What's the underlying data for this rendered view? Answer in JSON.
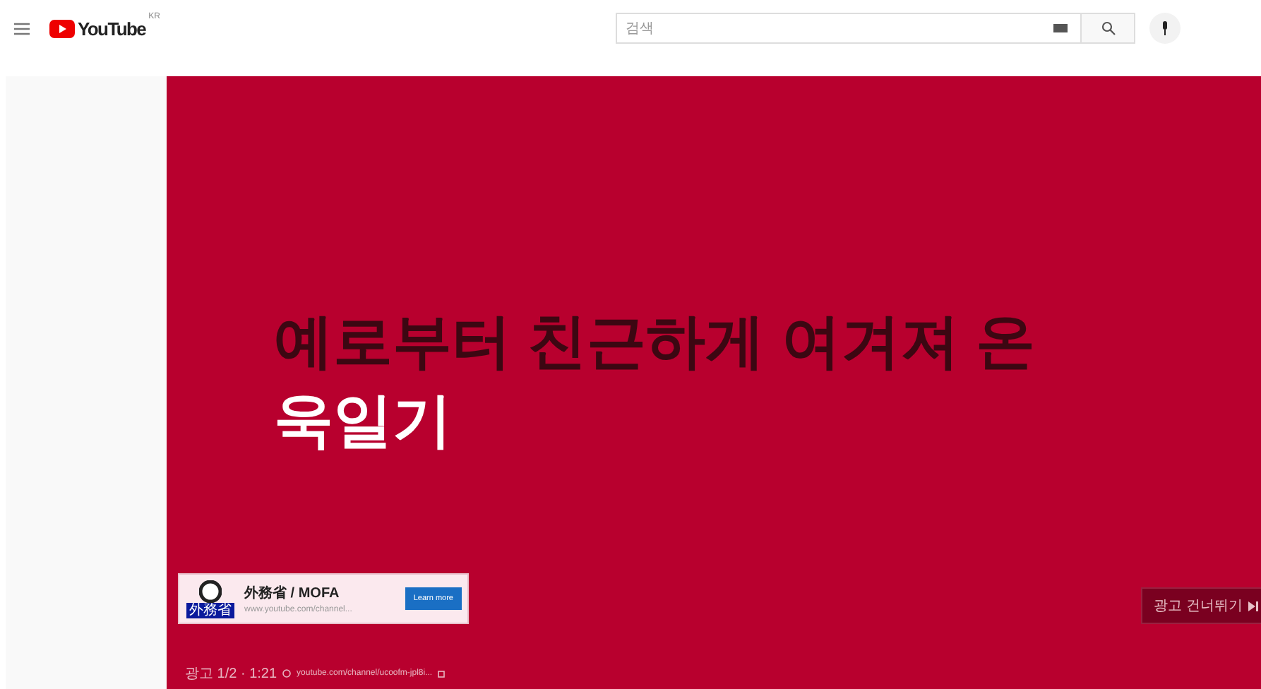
{
  "header": {
    "logo": "YouTube",
    "region": "KR",
    "search": {
      "placeholder": "검색"
    }
  },
  "video": {
    "headline": [
      {
        "text": "예로부터 친근하게 여겨져 온",
        "kind": "dark"
      },
      {
        "text": "욱일기",
        "kind": "light"
      }
    ],
    "ad_card": {
      "emblem_caption": "外務省",
      "title": "外務省 / MOFA",
      "url": "www.youtube.com/channel...",
      "button": "Learn more"
    },
    "skip_button": "광고 건너뛰기",
    "ad_info": {
      "counter": "광고 1/2 · 1:21",
      "link": "youtube.com/channel/ucoofm-jpl8i..."
    }
  }
}
